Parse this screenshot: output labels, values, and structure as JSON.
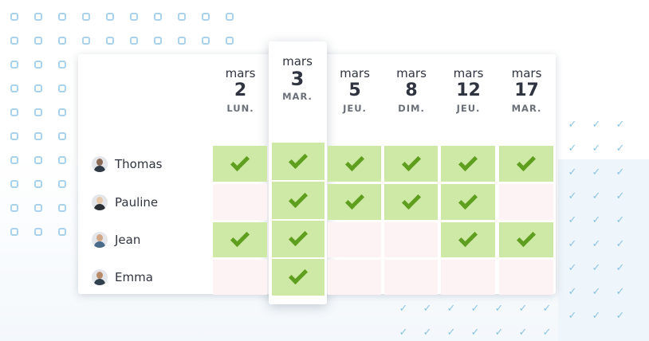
{
  "columns": [
    {
      "month": "mars",
      "day": "2",
      "weekday": "LUN."
    },
    {
      "month": "mars",
      "day": "3",
      "weekday": "MAR."
    },
    {
      "month": "mars",
      "day": "5",
      "weekday": "JEU."
    },
    {
      "month": "mars",
      "day": "8",
      "weekday": "DIM."
    },
    {
      "month": "mars",
      "day": "12",
      "weekday": "JEU."
    },
    {
      "month": "mars",
      "day": "17",
      "weekday": "MAR."
    }
  ],
  "highlighted_column": 1,
  "people": [
    {
      "name": "Thomas",
      "avatar": "avatar-thomas",
      "availability": [
        true,
        true,
        true,
        true,
        true,
        true
      ]
    },
    {
      "name": "Pauline",
      "avatar": "avatar-pauline",
      "availability": [
        false,
        true,
        true,
        true,
        true,
        false
      ]
    },
    {
      "name": "Jean",
      "avatar": "avatar-jean",
      "availability": [
        true,
        true,
        false,
        false,
        true,
        true
      ]
    },
    {
      "name": "Emma",
      "avatar": "avatar-emma",
      "availability": [
        false,
        true,
        false,
        false,
        false,
        false
      ]
    }
  ],
  "colors": {
    "available": "#cde9a5",
    "unavailable": "#fdf3f4",
    "check": "#5f9f1f",
    "decor_square": "#a9d2ec",
    "decor_tick": "#8cc3e4"
  },
  "icons": {
    "check": "check-icon"
  }
}
